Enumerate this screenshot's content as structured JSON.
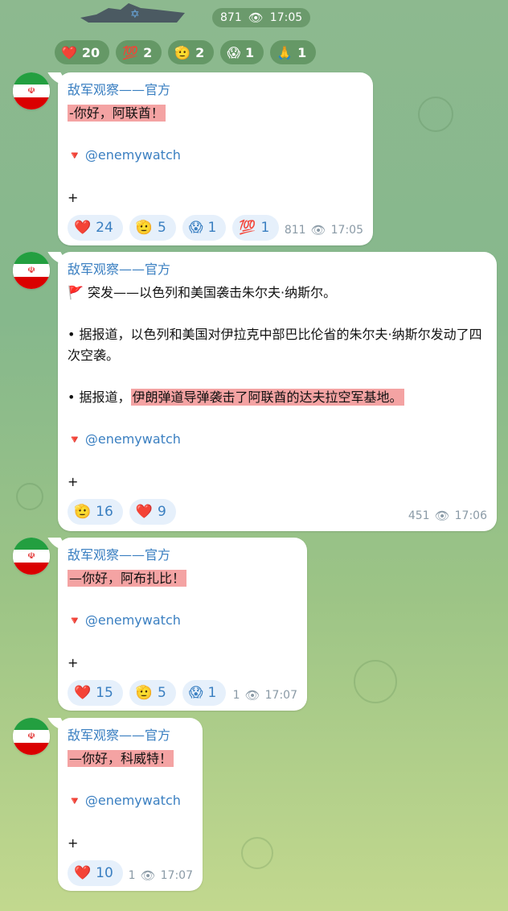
{
  "top": {
    "views": "871",
    "time": "17:05",
    "reactions": [
      {
        "emoji": "❤️",
        "count": "20"
      },
      {
        "emoji": "💯",
        "count": "2"
      },
      {
        "emoji": "🫡",
        "count": "2"
      },
      {
        "emoji": "😱",
        "count": "1"
      },
      {
        "emoji": "🙏",
        "count": "1"
      }
    ]
  },
  "messages": [
    {
      "sender": "敌军观察——官方",
      "lines": [
        {
          "text": "-你好，阿联酋！",
          "highlight": true
        },
        {
          "text": ""
        },
        {
          "text": "@enemywatch",
          "link": true,
          "flag": true
        },
        {
          "text": ""
        },
        {
          "text": "+"
        }
      ],
      "reactions": [
        {
          "emoji": "❤️",
          "count": "24"
        },
        {
          "emoji": "🫡",
          "count": "5"
        },
        {
          "emoji": "😱",
          "count": "1"
        },
        {
          "emoji": "💯",
          "count": "1"
        }
      ],
      "views": "811",
      "time": "17:05"
    },
    {
      "sender": "敌军观察——官方",
      "lines": [
        {
          "text": "突发——以色列和美国袭击朱尔夫·纳斯尔。",
          "redflag": true
        },
        {
          "text": ""
        },
        {
          "text": "• 据报道，以色列和美国对伊拉克中部巴比伦省的朱尔夫·纳斯尔发动了四次空袭。"
        },
        {
          "text": ""
        },
        {
          "pre": "• 据报道，",
          "text": "伊朗弹道导弹袭击了阿联酋的达夫拉空军基地。",
          "highlight": true
        },
        {
          "text": ""
        },
        {
          "text": "@enemywatch",
          "link": true,
          "flag": true
        },
        {
          "text": ""
        },
        {
          "text": "+"
        }
      ],
      "reactions": [
        {
          "emoji": "🫡",
          "count": "16"
        },
        {
          "emoji": "❤️",
          "count": "9"
        }
      ],
      "views": "451",
      "time": "17:06"
    },
    {
      "sender": "敌军观察——官方",
      "lines": [
        {
          "text": "—你好，阿布扎比！",
          "highlight": true
        },
        {
          "text": ""
        },
        {
          "text": "@enemywatch",
          "link": true,
          "flag": true
        },
        {
          "text": ""
        },
        {
          "text": "+"
        }
      ],
      "reactions": [
        {
          "emoji": "❤️",
          "count": "15"
        },
        {
          "emoji": "🫡",
          "count": "5"
        },
        {
          "emoji": "😱",
          "count": "1"
        }
      ],
      "views": "1",
      "time": "17:07"
    },
    {
      "sender": "敌军观察——官方",
      "lines": [
        {
          "text": "—你好，科威特！",
          "highlight": true
        },
        {
          "text": ""
        },
        {
          "text": "@enemywatch",
          "link": true,
          "flag": true
        },
        {
          "text": ""
        },
        {
          "text": "+"
        }
      ],
      "reactions": [
        {
          "emoji": "❤️",
          "count": "10"
        }
      ],
      "views": "1",
      "time": "17:07"
    }
  ]
}
